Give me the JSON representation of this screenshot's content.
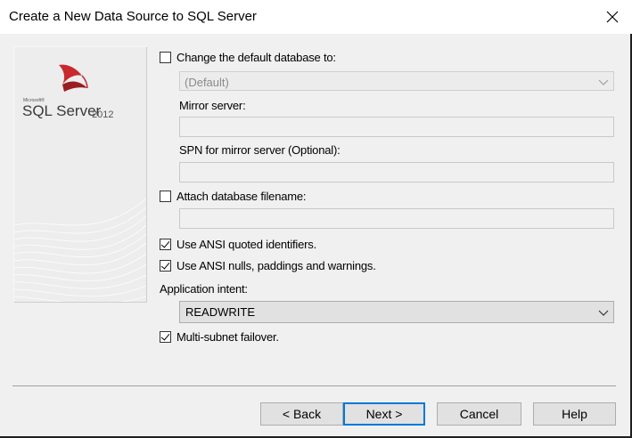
{
  "window": {
    "title": "Create a New Data Source to SQL Server",
    "close_glyph": "✕"
  },
  "banner": {
    "microsoft": "Microsoft®",
    "product": "SQL Server",
    "version": "2012"
  },
  "options": {
    "change_db": {
      "label": "Change the default database to:",
      "checked": false
    },
    "default_db": {
      "value": "(Default)"
    },
    "mirror_server": {
      "label": "Mirror server:",
      "value": ""
    },
    "spn_mirror": {
      "label": "SPN for mirror server (Optional):",
      "value": ""
    },
    "attach_db": {
      "label": "Attach database filename:",
      "checked": false,
      "value": ""
    },
    "ansi_quoted": {
      "label": "Use ANSI quoted identifiers.",
      "checked": true
    },
    "ansi_nulls": {
      "label": "Use ANSI nulls, paddings and warnings.",
      "checked": true
    },
    "app_intent": {
      "label": "Application intent:",
      "value": "READWRITE"
    },
    "multi_subnet": {
      "label": "Multi-subnet failover.",
      "checked": true
    }
  },
  "buttons": {
    "back": "< Back",
    "next": "Next >",
    "cancel": "Cancel",
    "help": "Help"
  },
  "colors": {
    "accent": "#0078d7",
    "window_bg": "#f0f0f0",
    "button_bg": "#e1e1e1"
  }
}
